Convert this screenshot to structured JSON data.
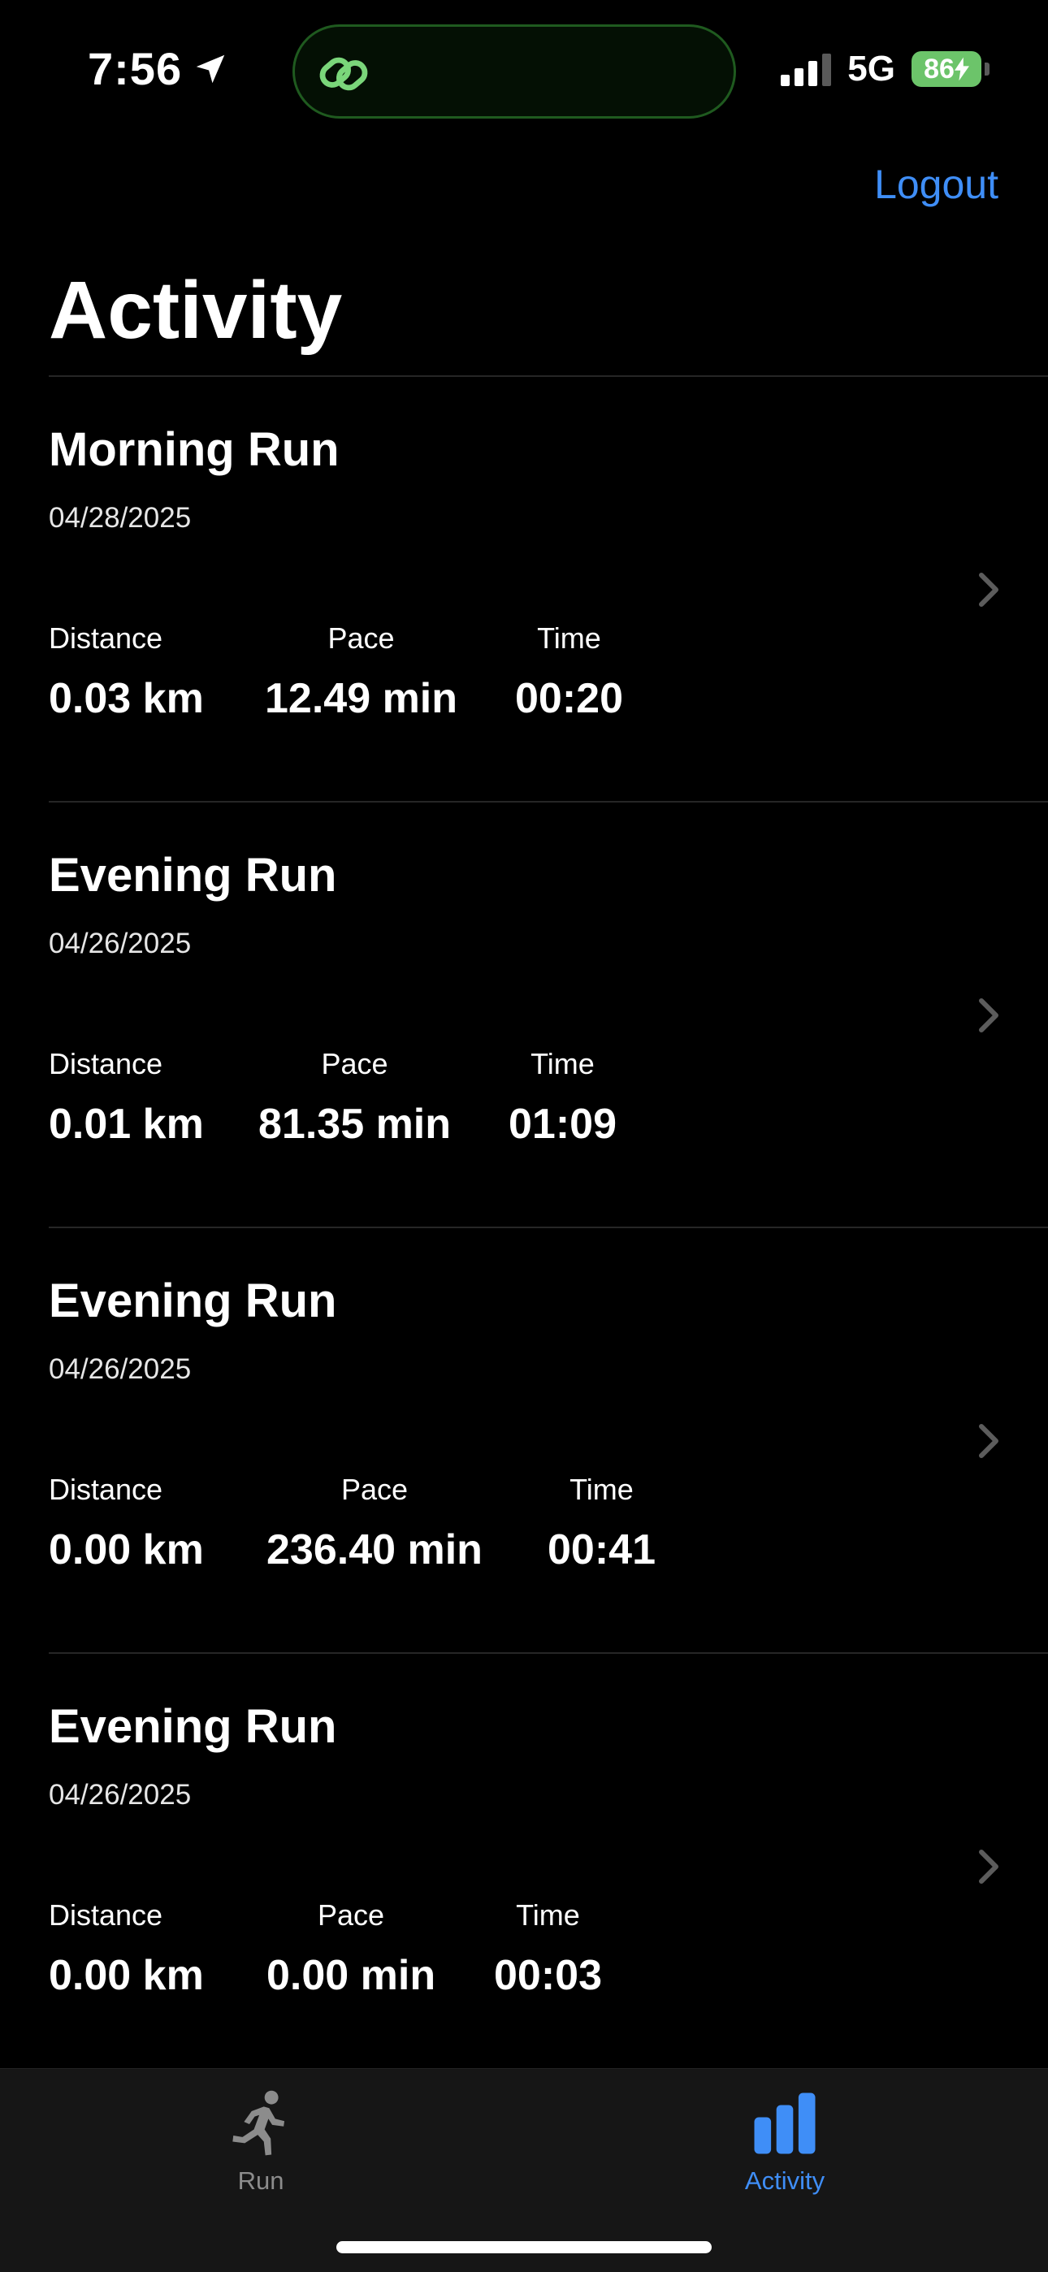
{
  "status_bar": {
    "time": "7:56",
    "network": "5G",
    "battery": "86"
  },
  "header": {
    "logout_label": "Logout",
    "title": "Activity"
  },
  "activities": [
    {
      "title": "Morning Run",
      "date": "04/28/2025",
      "distance_label": "Distance",
      "distance": "0.03 km",
      "pace_label": "Pace",
      "pace": "12.49 min",
      "time_label": "Time",
      "time": "00:20"
    },
    {
      "title": "Evening Run",
      "date": "04/26/2025",
      "distance_label": "Distance",
      "distance": "0.01 km",
      "pace_label": "Pace",
      "pace": "81.35 min",
      "time_label": "Time",
      "time": "01:09"
    },
    {
      "title": "Evening Run",
      "date": "04/26/2025",
      "distance_label": "Distance",
      "distance": "0.00 km",
      "pace_label": "Pace",
      "pace": "236.40 min",
      "time_label": "Time",
      "time": "00:41"
    },
    {
      "title": "Evening Run",
      "date": "04/26/2025",
      "distance_label": "Distance",
      "distance": "0.00 km",
      "pace_label": "Pace",
      "pace": "0.00 min",
      "time_label": "Time",
      "time": "00:03"
    }
  ],
  "tab_bar": {
    "tabs": [
      {
        "label": "Run",
        "icon": "running-person-icon",
        "selected": false
      },
      {
        "label": "Activity",
        "icon": "bar-chart-icon",
        "selected": true
      }
    ]
  },
  "colors": {
    "accent": "#3f8ef7",
    "background": "#000000",
    "battery": "#6cc46a",
    "island_icon": "#7ad67a"
  }
}
